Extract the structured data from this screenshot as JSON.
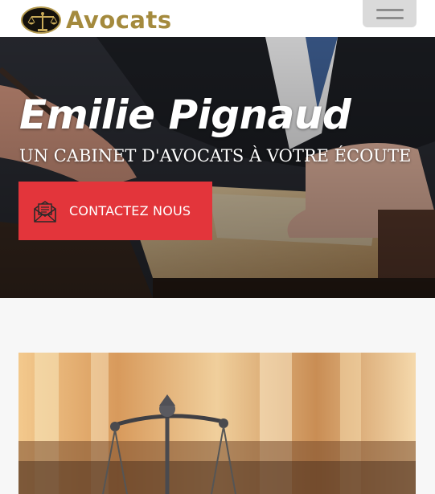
{
  "header": {
    "logo_text": "Avocats",
    "logo_icon": "scales-of-justice-icon",
    "menu_icon": "hamburger-menu-icon"
  },
  "hero": {
    "title": "Emilie Pignaud",
    "subtitle": "UN CABINET D'AVOCATS À VOTRE ÉCOUTE",
    "cta_label": "CONTACTEZ NOUS",
    "cta_icon": "envelope-letter-icon"
  },
  "colors": {
    "accent": "#e3353b",
    "logo_gold": "#a48a3d",
    "menu_button": "#dadada"
  }
}
